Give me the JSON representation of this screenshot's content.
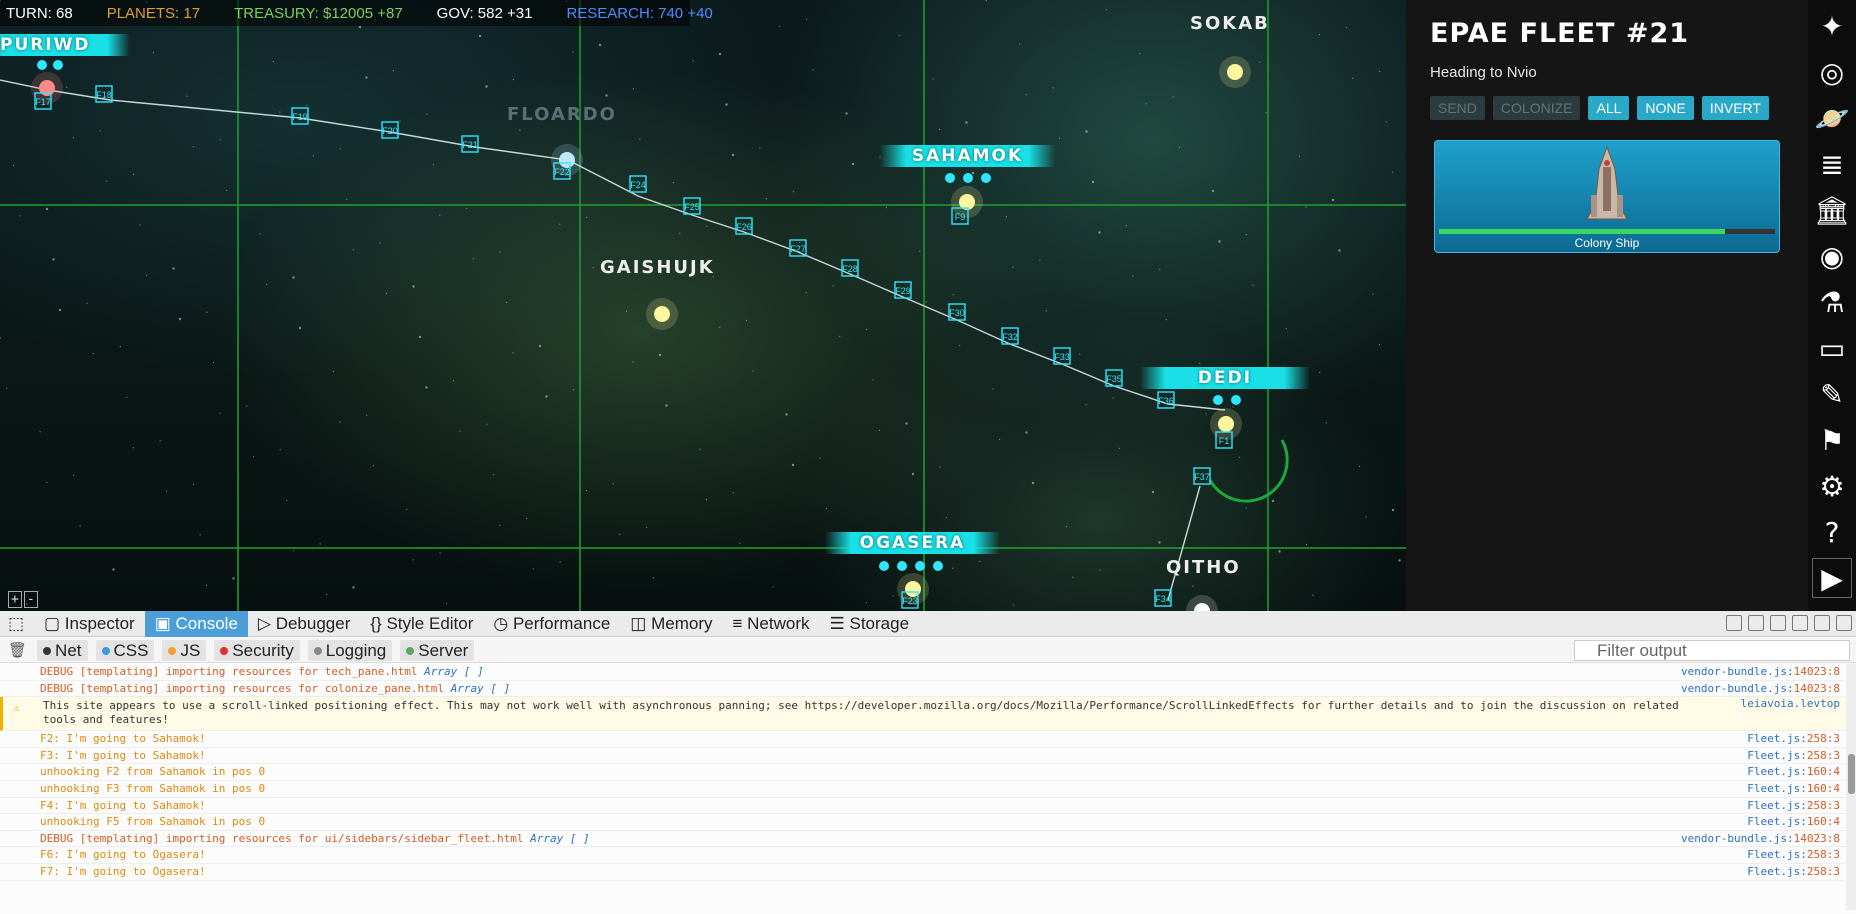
{
  "status": {
    "turn": "TURN: 68",
    "planets": "PLANETS: 17",
    "treasury": "TREASURY: $12005 +87",
    "gov": "GOV: 582 +31",
    "research": "RESEARCH: 740 +40",
    "colors": {
      "turn": "#ffffff",
      "planets": "#e0a030",
      "treasury": "#7fcf5a",
      "gov": "#ffffff",
      "research": "#4f8cff"
    }
  },
  "map": {
    "stars": [
      {
        "name": "PURIWD",
        "style": "banner"
      },
      {
        "name": "FLOARDO",
        "style": "dim"
      },
      {
        "name": "SAHAMOK",
        "style": "banner"
      },
      {
        "name": "SOKAB",
        "style": "plain"
      },
      {
        "name": "GAISHUJK",
        "style": "plain"
      },
      {
        "name": "DEDI",
        "style": "banner"
      },
      {
        "name": "OGASERA",
        "style": "banner"
      },
      {
        "name": "QITHO",
        "style": "plain"
      }
    ],
    "route_markers": [
      "F17",
      "F18",
      "F19",
      "F20",
      "F21",
      "F22",
      "F24",
      "F25",
      "F26",
      "F27",
      "F28",
      "F29",
      "F30",
      "F32",
      "F33",
      "F35",
      "F36",
      "F1",
      "F37",
      "F34",
      "F23",
      "F9"
    ],
    "zoom_controls": [
      "+",
      "-"
    ]
  },
  "sidebar": {
    "fleet_title": "EPAE FLEET #21",
    "heading": "Heading to Nvio",
    "buttons": [
      {
        "label": "SEND",
        "enabled": false
      },
      {
        "label": "COLONIZE",
        "enabled": false
      },
      {
        "label": "ALL",
        "enabled": true
      },
      {
        "label": "NONE",
        "enabled": true
      },
      {
        "label": "INVERT",
        "enabled": true
      }
    ],
    "ship": {
      "name": "Colony Ship",
      "health": 0.85
    }
  },
  "iconbar": [
    "sparkle-icon",
    "galaxy-icon",
    "planet-icon",
    "database-icon",
    "bank-icon",
    "eye-icon",
    "flask-icon",
    "chat-icon",
    "design-icon",
    "flag-icon",
    "gear-icon",
    "help-icon",
    "play-icon"
  ],
  "devtools": {
    "tabs": [
      "Inspector",
      "Console",
      "Debugger",
      "Style Editor",
      "Performance",
      "Memory",
      "Network",
      "Storage"
    ],
    "selected_tab": "Console",
    "filters": [
      {
        "label": "Net",
        "color": "#333333"
      },
      {
        "label": "CSS",
        "color": "#3b9ae1"
      },
      {
        "label": "JS",
        "color": "#f0a030"
      },
      {
        "label": "Security",
        "color": "#e03030"
      },
      {
        "label": "Logging",
        "color": "#888888"
      },
      {
        "label": "Server",
        "color": "#5aa860"
      }
    ],
    "filter_placeholder": "Filter output",
    "log": [
      {
        "text": "DEBUG [templating] importing resources for tech_pane.html ",
        "arr": "Array [  ]",
        "src": "vendor-bundle.js:",
        "line": "14023:8",
        "color": "#d35d24"
      },
      {
        "text": "DEBUG [templating] importing resources for colonize_pane.html ",
        "arr": "Array [  ]",
        "src": "vendor-bundle.js:",
        "line": "14023:8",
        "color": "#d35d24"
      },
      {
        "text": "This site appears to use a scroll-linked positioning effect. This may not work well with asynchronous panning; see https://developer.mozilla.org/docs/Mozilla/Performance/ScrollLinkedEffects for further details and to join the discussion on related tools and features!",
        "arr": "",
        "src": "leiavoia.levtop",
        "line": "",
        "color": "#333333",
        "warn": true
      },
      {
        "text": "F2: I'm going to Sahamok!",
        "arr": "",
        "src": "Fleet.js:",
        "line": "258:3",
        "color": "#e08a10"
      },
      {
        "text": "F3: I'm going to Sahamok!",
        "arr": "",
        "src": "Fleet.js:",
        "line": "258:3",
        "color": "#e08a10"
      },
      {
        "text": "unhooking F2 from Sahamok in pos 0",
        "arr": "",
        "src": "Fleet.js:",
        "line": "160:4",
        "color": "#e08a10"
      },
      {
        "text": "unhooking F3 from Sahamok in pos 0",
        "arr": "",
        "src": "Fleet.js:",
        "line": "160:4",
        "color": "#e08a10"
      },
      {
        "text": "F4: I'm going to Sahamok!",
        "arr": "",
        "src": "Fleet.js:",
        "line": "258:3",
        "color": "#e08a10"
      },
      {
        "text": "unhooking F5 from Sahamok in pos 0",
        "arr": "",
        "src": "Fleet.js:",
        "line": "160:4",
        "color": "#e08a10"
      },
      {
        "text": "DEBUG [templating] importing resources for ui/sidebars/sidebar_fleet.html ",
        "arr": "Array [  ]",
        "src": "vendor-bundle.js:",
        "line": "14023:8",
        "color": "#d35d24"
      },
      {
        "text": "F6: I'm going to Ogasera!",
        "arr": "",
        "src": "Fleet.js:",
        "line": "258:3",
        "color": "#e08a10"
      },
      {
        "text": "F7: I'm going to Ogasera!",
        "arr": "",
        "src": "Fleet.js:",
        "line": "258:3",
        "color": "#e08a10"
      }
    ]
  }
}
